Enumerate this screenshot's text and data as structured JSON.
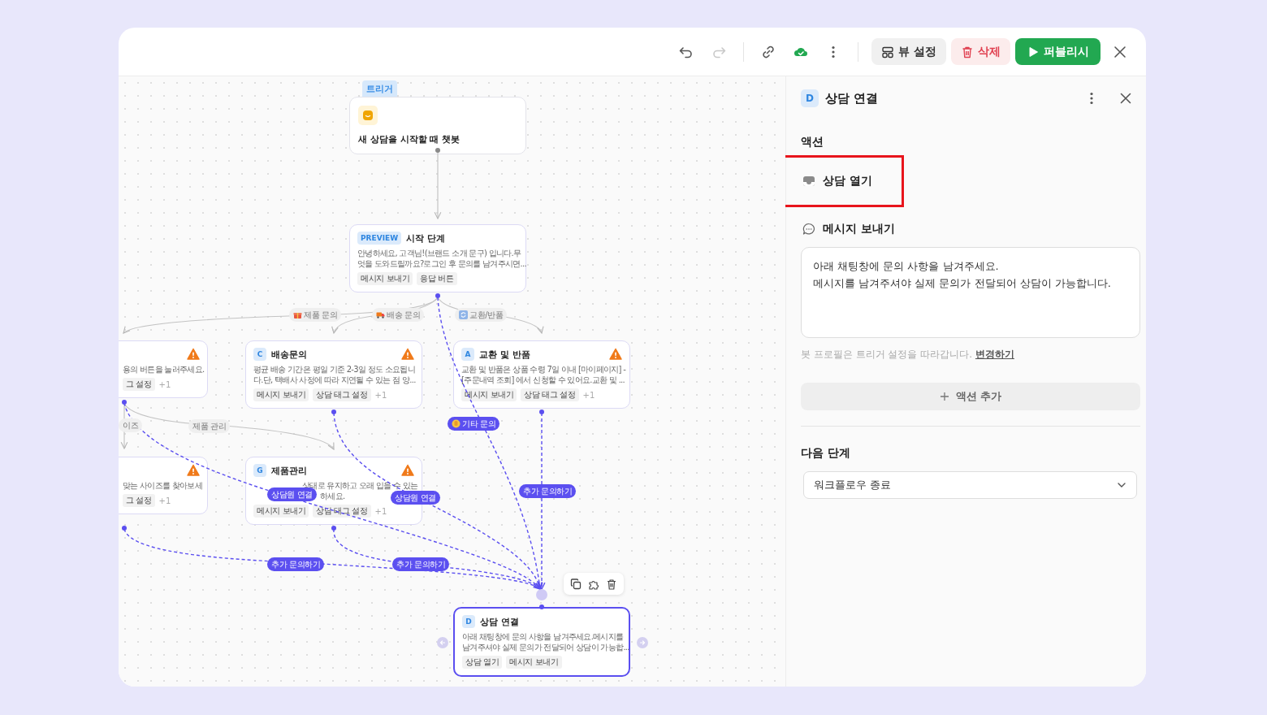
{
  "toolbar": {
    "icons": [
      {
        "kind": "undo",
        "disabled": false
      },
      {
        "kind": "redo",
        "disabled": true
      },
      {
        "kind": "link",
        "disabled": false
      },
      {
        "kind": "saved",
        "disabled": false
      },
      {
        "kind": "more",
        "disabled": false
      }
    ],
    "buttons": [
      {
        "kind": "view",
        "label": "뷰 설정"
      },
      {
        "kind": "delete",
        "label": "삭제"
      },
      {
        "kind": "publish",
        "label": "퍼블리시"
      }
    ]
  },
  "canvas": {
    "trigger": {
      "tag": "트리거",
      "title": "새 상담을 시작할 때 챗봇"
    },
    "nodes": [
      {
        "badge": "PREVIEW",
        "title": "시작 단계",
        "description": [
          "안녕하세요, 고객님!(브랜드 소개 문구) 입니다.무",
          "엇을 도와드릴까요?로그인 후 문의를 남겨주시면..."
        ],
        "chips": [
          "메시지 보내기",
          "응답 버튼"
        ],
        "warning": false,
        "selected": false
      },
      {
        "description": [
          "용의 버튼을 눌러주세요."
        ],
        "chips": [
          "그 설정"
        ],
        "more": "+1",
        "warning": true,
        "selected": false
      },
      {
        "badge": "C",
        "title": "배송문의",
        "description": [
          "평균 배송 기간은 평일 기준 2-3일 정도 소요됩니",
          "다.단, 택배사 사정에 따라 지연될 수 있는 점 양..."
        ],
        "chips": [
          "메시지 보내기",
          "상담 태그 설정"
        ],
        "more": "+1",
        "warning": true,
        "selected": false
      },
      {
        "badge": "A",
        "title": "교환 및 반품",
        "description": [
          "교환 및 반품은 상품 수령 7일 이내 [마이페이지] -",
          "[주문내역 조회] 에서 신청할 수 있어요.교환 및 ..."
        ],
        "chips": [
          "메시지 보내기",
          "상담 태그 설정"
        ],
        "more": "+1",
        "warning": true,
        "selected": false
      },
      {
        "description": [
          "맞는 사이즈를 찾아보세"
        ],
        "chips": [
          "그 설정"
        ],
        "more": "+1",
        "warning": true,
        "selected": false
      },
      {
        "badge": "G",
        "title": "제품관리",
        "description": [
          "상태로 유지하고 오래 입을 수 있는",
          "하세요."
        ],
        "chips": [
          "메시지 보내기",
          "상담 태그 설정"
        ],
        "more": "+1",
        "warning": true,
        "selected": false
      },
      {
        "badge": "D",
        "title": "상담 연결",
        "description": [
          "아래 채팅창에 문의 사항을 남겨주세요.메시지를",
          "남겨주셔야 실제 문의가 전달되어 상담이 가능합..."
        ],
        "chips": [
          "상담 열기",
          "메시지 보내기"
        ],
        "warning": false,
        "selected": true
      }
    ],
    "edge_labels": [
      {
        "text": "제품 문의",
        "kind": "neutral"
      },
      {
        "text": "배송 문의",
        "kind": "neutral"
      },
      {
        "text": "교환/반품",
        "kind": "neutral"
      },
      {
        "text": "이즈",
        "kind": "neutral"
      },
      {
        "text": "제품 관리",
        "kind": "neutral"
      },
      {
        "text": "기타 문의",
        "kind": "accent"
      },
      {
        "text": "추가 문의하기",
        "kind": "accent"
      },
      {
        "text": "상담원 연결",
        "kind": "accent"
      },
      {
        "text": "상담원 연결",
        "kind": "accent"
      },
      {
        "text": "추가 문의하기",
        "kind": "accent"
      },
      {
        "text": "추가 문의하기",
        "kind": "accent"
      }
    ]
  },
  "panel": {
    "badge": "D",
    "title": "상담 연결",
    "actions_heading": "액션",
    "actions": [
      {
        "kind": "open",
        "label": "상담 열기",
        "highlighted": true
      },
      {
        "kind": "message",
        "label": "메시지 보내기",
        "highlighted": false
      }
    ],
    "message_lines": [
      "아래 채팅창에 문의 사항을 남겨주세요.",
      "메시지를 남겨주셔야 실제 문의가 전달되어 상담이 가능합니다."
    ],
    "hint": "봇 프로필은 트리거 설정을 따라갑니다.",
    "hint_link": "변경하기",
    "add_action": "액션 추가",
    "next_heading": "다음 단계",
    "next_value": "워크플로우 종료"
  }
}
